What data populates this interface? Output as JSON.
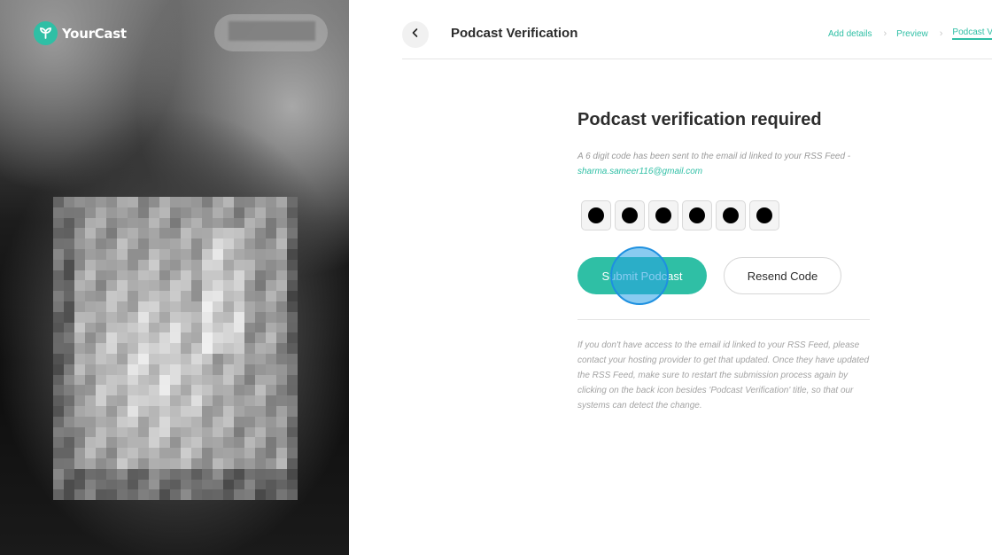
{
  "brand": {
    "name": "YourCast",
    "accent_color": "#2fbfa5"
  },
  "header": {
    "back_icon": "chevron-left-icon",
    "title": "Podcast Verification",
    "breadcrumb": [
      {
        "label": "Add details"
      },
      {
        "label": "Preview"
      },
      {
        "label": "Podcast V"
      }
    ]
  },
  "verification": {
    "title": "Podcast verification required",
    "info_text": "A 6 digit code has been sent to the email id linked to your RSS Feed -",
    "email": "sharma.sameer116@gmail.com",
    "code_length": 6,
    "submit_label": "Submit Podcast",
    "resend_label": "Resend Code",
    "help_text": "If you don't have access to the email id linked to your RSS Feed, please contact your hosting provider to get that updated. Once they have updated the RSS Feed, make sure to restart the submission process again by clicking on the back icon besides 'Podcast Verification' title, so that our systems can detect the change."
  }
}
